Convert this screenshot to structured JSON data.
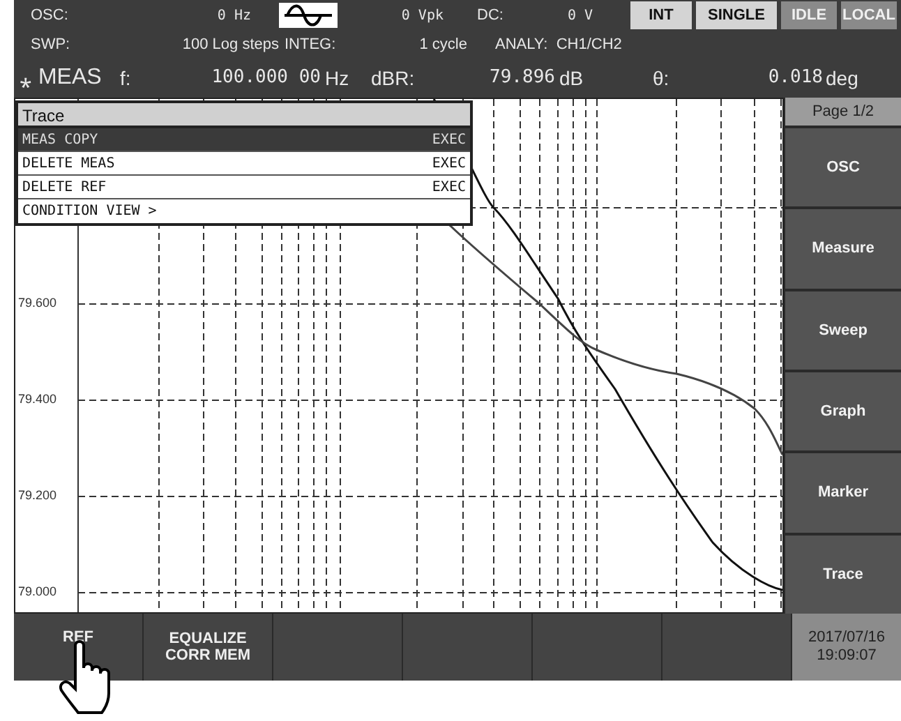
{
  "header": {
    "row1": [
      {
        "kind": "label",
        "text": "OSC:"
      },
      {
        "kind": "value",
        "text": "0 Hz"
      },
      {
        "kind": "waveform"
      },
      {
        "kind": "value",
        "text": "0 Vpk"
      },
      {
        "kind": "label",
        "text": "DC:"
      },
      {
        "kind": "value",
        "text": "0 V"
      }
    ],
    "status_buttons": [
      {
        "label": "INT",
        "active": false
      },
      {
        "label": "SINGLE",
        "active": false
      },
      {
        "label": "IDLE",
        "active": true
      },
      {
        "label": "LOCAL",
        "active": true
      }
    ],
    "row2": [
      "SWP:",
      "100 Log steps",
      "INTEG:",
      "1 cycle",
      "ANALY:  CH1/CH2"
    ],
    "meas": {
      "mode": "⁎ MEAS",
      "f_label": "f:",
      "f_value": "100.000 00",
      "f_unit": "Hz",
      "dbr_label": "dBR:",
      "dbr_value": "79.896",
      "dbr_unit": "dB",
      "theta_label": "θ:",
      "theta_value": "0.018",
      "theta_unit": "deg"
    }
  },
  "menu": {
    "title": "Trace",
    "items": [
      {
        "label": "MEAS COPY",
        "action": "EXEC",
        "selected": true
      },
      {
        "label": "DELETE MEAS",
        "action": "EXEC",
        "selected": false
      },
      {
        "label": "DELETE REF",
        "action": "EXEC",
        "selected": false
      },
      {
        "label": "CONDITION VIEW >",
        "selected": false
      }
    ]
  },
  "graph": {
    "y_labels": [
      "79.600",
      "79.400",
      "79.200",
      "79.000"
    ]
  },
  "side": {
    "page": "Page 1/2",
    "buttons": [
      "OSC",
      "Measure",
      "Sweep",
      "Graph",
      "Marker",
      "Trace"
    ]
  },
  "bottom": {
    "buttons": [
      {
        "kind": "labeled",
        "label": "REF"
      },
      {
        "kind": "labeled",
        "label": "EQUALIZE\nCORR MEM"
      },
      {
        "kind": "blank"
      },
      {
        "kind": "blank"
      },
      {
        "kind": "blank"
      },
      {
        "kind": "blank"
      }
    ],
    "date": "2017/07/16",
    "time": "19:09:07"
  }
}
